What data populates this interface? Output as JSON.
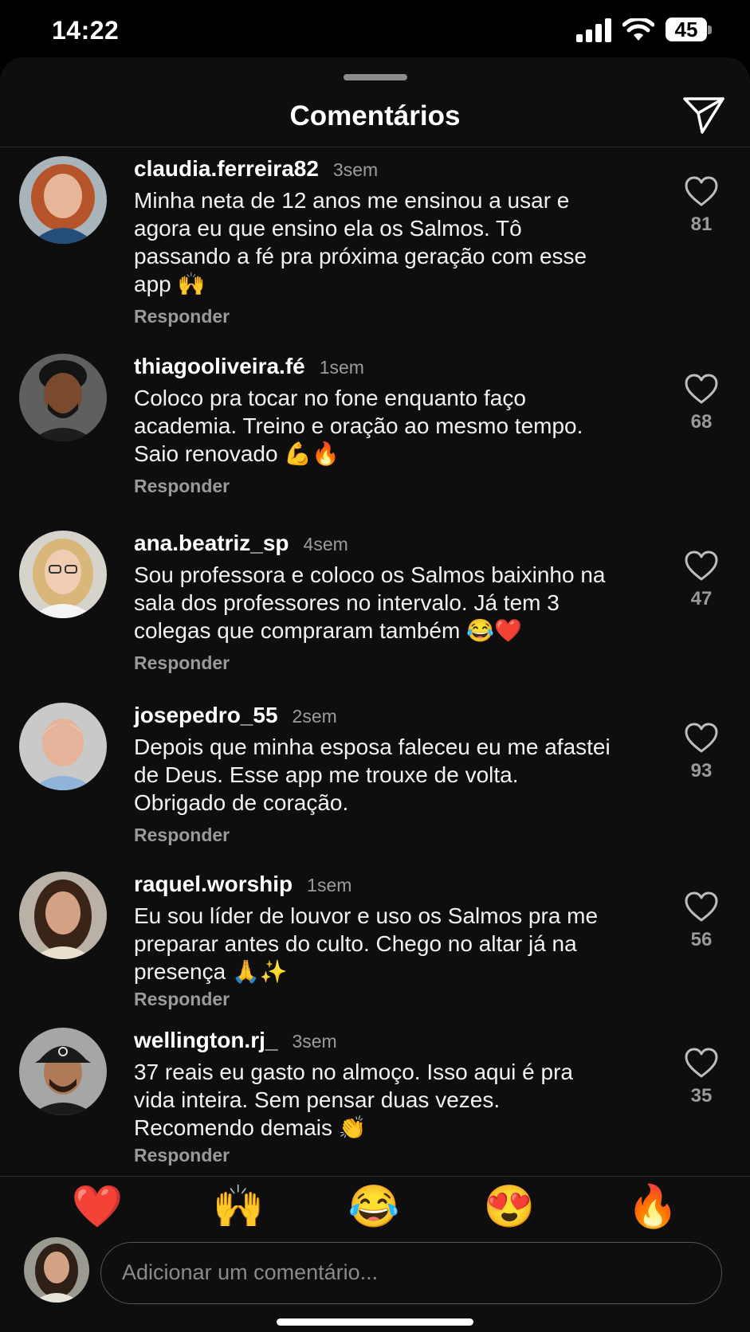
{
  "status_bar": {
    "time": "14:22",
    "battery": "45",
    "icons": [
      "signal-icon",
      "wifi-icon",
      "battery-icon"
    ]
  },
  "sheet": {
    "title": "Comentários",
    "send_icon": "paper-plane-icon"
  },
  "comments": [
    {
      "username": "claudia.ferreira82",
      "time": "3sem",
      "text": "Minha neta de 12 anos me ensinou a usar e agora eu que ensino ela os Salmos. Tô passando a fé pra próxima geração com esse app 🙌",
      "reply": "Responder",
      "likes": "81"
    },
    {
      "username": "thiagooliveira.fé",
      "time": "1sem",
      "text": "Coloco pra tocar no fone enquanto faço academia. Treino e oração ao mesmo tempo. Saio renovado 💪🔥",
      "reply": "Responder",
      "likes": "68"
    },
    {
      "username": "ana.beatriz_sp",
      "time": "4sem",
      "text": "Sou professora e coloco os Salmos baixinho na sala dos professores no intervalo. Já tem 3 colegas que compraram também 😂❤️",
      "reply": "Responder",
      "likes": "47"
    },
    {
      "username": "josepedro_55",
      "time": "2sem",
      "text": "Depois que minha esposa faleceu eu me afastei de Deus. Esse app me trouxe de volta. Obrigado de coração.",
      "reply": "Responder",
      "likes": "93"
    },
    {
      "username": "raquel.worship",
      "time": "1sem",
      "text": "Eu sou líder de louvor e uso os Salmos pra me preparar antes do culto. Chego no altar já na presença 🙏✨",
      "reply": "Responder",
      "likes": "56"
    },
    {
      "username": "wellington.rj_",
      "time": "3sem",
      "text": "37 reais eu gasto no almoço. Isso aqui é pra vida inteira. Sem pensar duas vezes. Recomendo demais 👏",
      "reply": "Responder",
      "likes": "35"
    }
  ],
  "reactions": [
    "❤️",
    "🙌",
    "😂",
    "😍",
    "🔥"
  ],
  "composer": {
    "placeholder": "Adicionar um comentário..."
  },
  "colors": {
    "background": "#000000",
    "sheet": "#0e0e0e",
    "muted_text": "#9a9a9a"
  }
}
